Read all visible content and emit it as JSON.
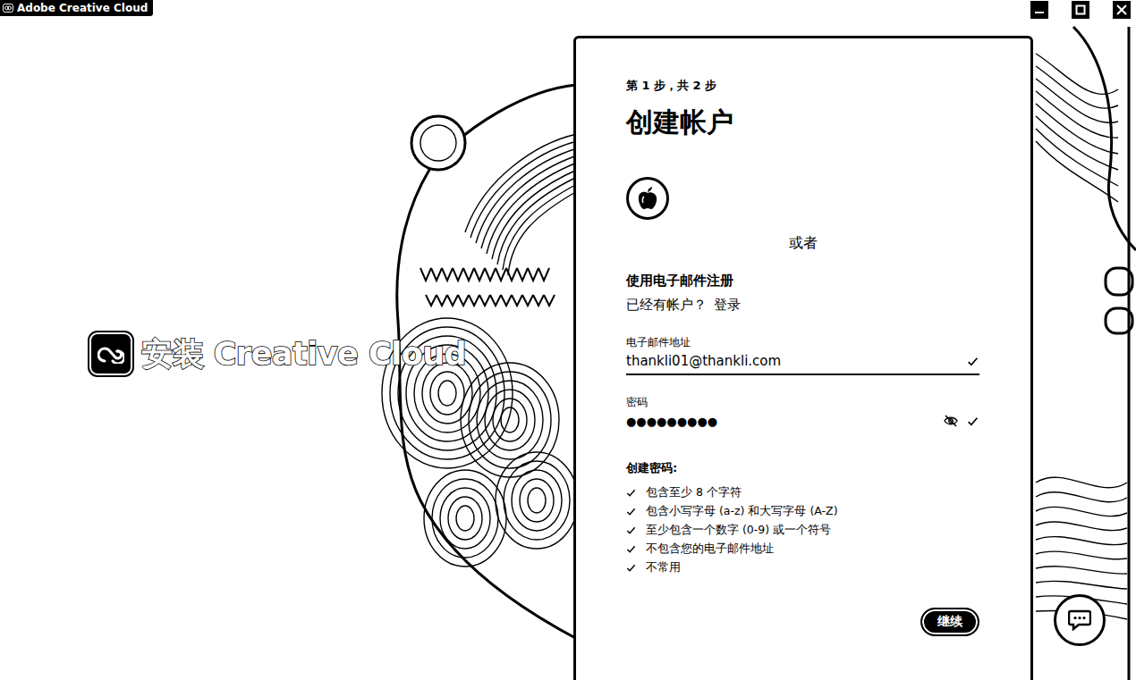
{
  "window": {
    "title": "Adobe Creative Cloud"
  },
  "hero": {
    "title": "安装 Creative Cloud"
  },
  "card": {
    "step": "第 1 步，共 2 步",
    "heading": "创建帐户",
    "divider": "或者",
    "email_signup": "使用电子邮件注册",
    "have_account": "已经有帐户？",
    "login": "登录",
    "email": {
      "label": "电子邮件地址",
      "value": "thankli01@thankli.com",
      "valid": true
    },
    "password": {
      "label": "密码",
      "value": "●●●●●●●●●",
      "valid": true,
      "visible": false
    },
    "requirements": {
      "title": "创建密码:",
      "items": [
        {
          "text": "包含至少 8 个字符",
          "met": true
        },
        {
          "text": "包含小写字母 (a-z) 和大写字母 (A-Z)",
          "met": true
        },
        {
          "text": "至少包含一个数字 (0-9) 或一个符号",
          "met": true
        },
        {
          "text": "不包含您的电子邮件地址",
          "met": true
        },
        {
          "text": "不常用",
          "met": true
        }
      ]
    },
    "continue": "继续"
  }
}
